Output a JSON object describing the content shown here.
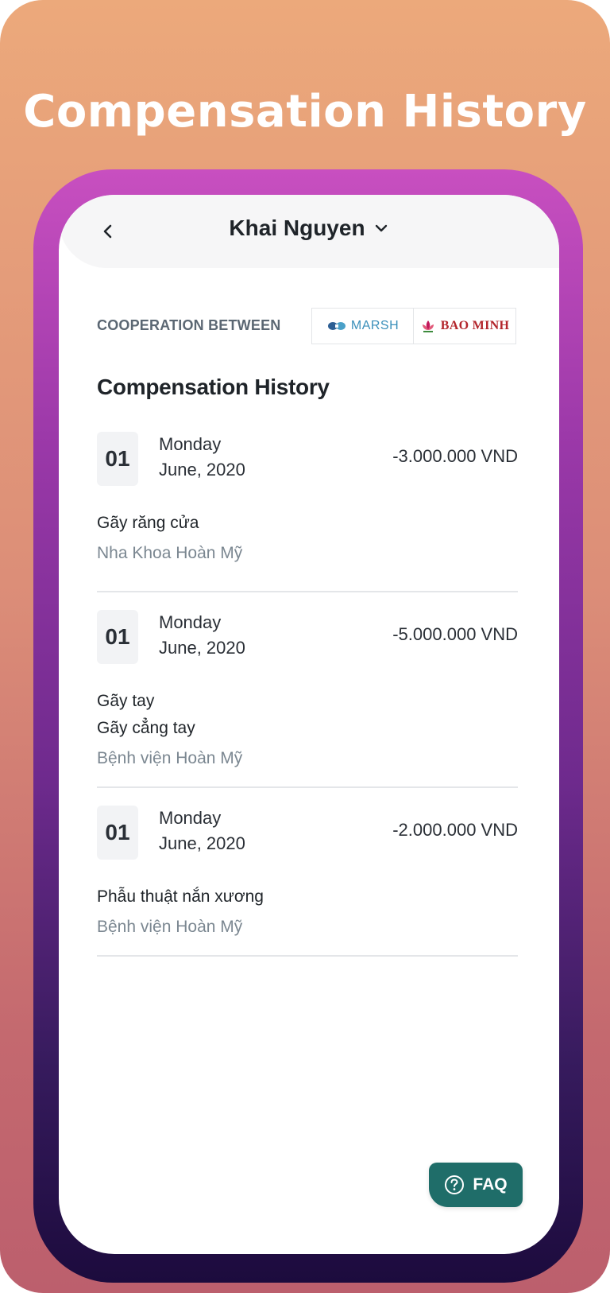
{
  "poster": {
    "title": "Compensation History"
  },
  "header": {
    "user_name": "Khai Nguyen"
  },
  "partners": {
    "label": "COOPERATION BETWEEN",
    "marsh": "MARSH",
    "bao_minh": "BAO MINH"
  },
  "main": {
    "title": "Compensation History",
    "entries": [
      {
        "day": "01",
        "weekday": "Monday",
        "month_year": "June, 2020",
        "amount": "-3.000.000 VND",
        "lines": [
          "Gãy răng cửa"
        ],
        "provider": "Nha Khoa Hoàn Mỹ"
      },
      {
        "day": "01",
        "weekday": "Monday",
        "month_year": "June, 2020",
        "amount": "-5.000.000 VND",
        "lines": [
          "Gãy tay",
          "Gãy cẳng tay"
        ],
        "provider": "Bệnh viện Hoàn Mỹ"
      },
      {
        "day": "01",
        "weekday": "Monday",
        "month_year": "June, 2020",
        "amount": "-2.000.000 VND",
        "lines": [
          "Phẫu thuật nắn xương"
        ],
        "provider": "Bệnh viện Hoàn Mỹ"
      }
    ]
  },
  "faq": {
    "label": "FAQ"
  },
  "colors": {
    "accent": "#1f6d69",
    "background_top": "#eca97b",
    "background_bottom": "#bc5f6d",
    "frame_top": "#c84fc0",
    "frame_bottom": "#1c0b3d"
  },
  "icons": {
    "back": "chevron-left-icon",
    "user_dropdown": "chevron-down-icon",
    "faq": "help-circle-icon"
  }
}
